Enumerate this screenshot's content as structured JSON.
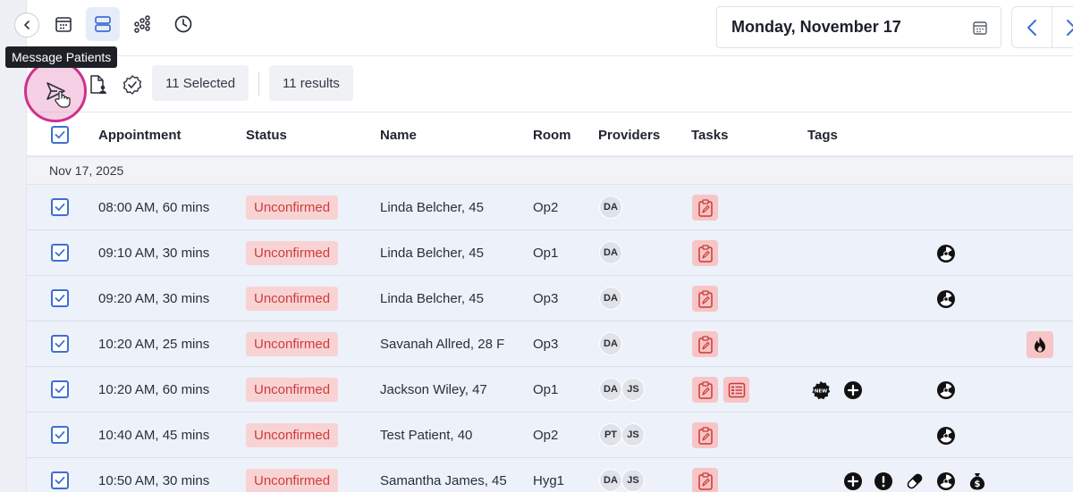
{
  "tooltip": "Message Patients",
  "date": {
    "label": "Monday, November 17"
  },
  "toolbar": {
    "selected": "11 Selected",
    "results": "11 results"
  },
  "columns": {
    "appointment": "Appointment",
    "status": "Status",
    "name": "Name",
    "room": "Room",
    "providers": "Providers",
    "tasks": "Tasks",
    "tags": "Tags"
  },
  "group": {
    "label": "Nov 17, 2025"
  },
  "rows": [
    {
      "time": "08:00 AM, 60 mins",
      "status": "Unconfirmed",
      "name": "Linda Belcher, 45",
      "room": "Op2",
      "providers": [
        "DA"
      ]
    },
    {
      "time": "09:10 AM, 30 mins",
      "status": "Unconfirmed",
      "name": "Linda Belcher, 45",
      "room": "Op1",
      "providers": [
        "DA"
      ]
    },
    {
      "time": "09:20 AM, 30 mins",
      "status": "Unconfirmed",
      "name": "Linda Belcher, 45",
      "room": "Op3",
      "providers": [
        "DA"
      ]
    },
    {
      "time": "10:20 AM, 25 mins",
      "status": "Unconfirmed",
      "name": "Savanah Allred, 28 F",
      "room": "Op3",
      "providers": [
        "DA"
      ]
    },
    {
      "time": "10:20 AM, 60 mins",
      "status": "Unconfirmed",
      "name": "Jackson Wiley, 47",
      "room": "Op1",
      "providers": [
        "DA",
        "JS"
      ]
    },
    {
      "time": "10:40 AM, 45 mins",
      "status": "Unconfirmed",
      "name": "Test Patient, 40",
      "room": "Op2",
      "providers": [
        "PT",
        "JS"
      ]
    },
    {
      "time": "10:50 AM, 30 mins",
      "status": "Unconfirmed",
      "name": "Samantha James, 45",
      "room": "Hyg1",
      "providers": [
        "DA",
        "JS"
      ]
    }
  ],
  "colors": {
    "accent": "#3f6fd0",
    "status_bg": "#f8d3d3",
    "status_text": "#d03b3b",
    "row_bg": "#edf1fa",
    "highlight": "#d0308a"
  }
}
